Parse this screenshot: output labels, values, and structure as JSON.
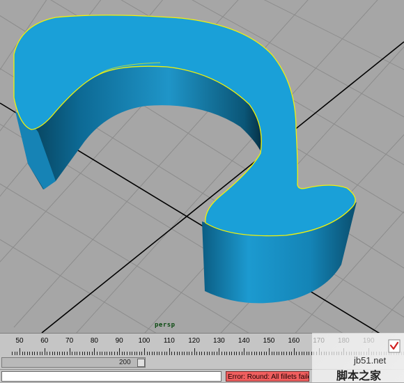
{
  "viewport": {
    "camera_label": "persp"
  },
  "time_slider": {
    "ticks": [
      "50",
      "60",
      "70",
      "80",
      "90",
      "100",
      "110",
      "120",
      "130",
      "140",
      "150",
      "160",
      "170",
      "180",
      "190"
    ]
  },
  "range_slider": {
    "end_value": "200"
  },
  "command_line": {
    "input_value": "",
    "error_text": "Error: Round: All fillets failed"
  },
  "watermark": {
    "url": "jb51.net",
    "text": "脚本之家"
  },
  "colors": {
    "viewport_bg": "#a6a6a6",
    "grid": "#8e8e8e",
    "axis": "#000000",
    "surface": "#1aa0d8",
    "wall_dark": "#0a4d6c",
    "selection_highlight": "#f2f20a",
    "error_bg": "#f05f5f"
  }
}
